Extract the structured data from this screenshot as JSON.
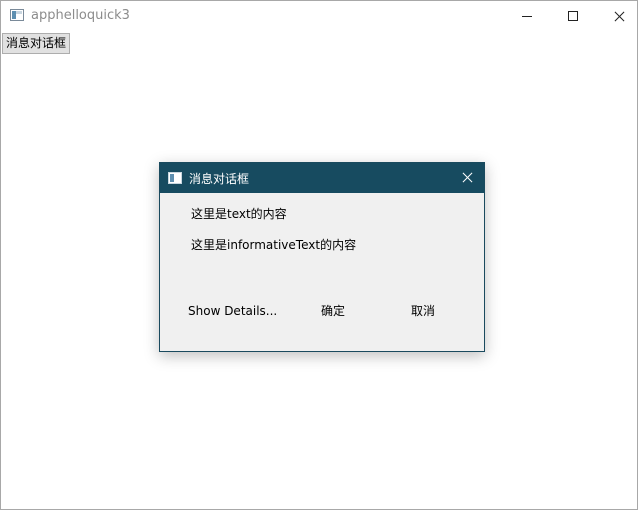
{
  "window": {
    "title": "apphelloquick3",
    "icon": "app-window-icon"
  },
  "main": {
    "message_button_label": "消息对话框"
  },
  "dialog": {
    "title": "消息对话框",
    "icon": "app-window-icon",
    "text": "这里是text的内容",
    "informative_text": "这里是informativeText的内容",
    "buttons": {
      "details_label": "Show Details...",
      "ok_label": "确定",
      "cancel_label": "取消"
    },
    "title_bar_color": "#174b60"
  }
}
